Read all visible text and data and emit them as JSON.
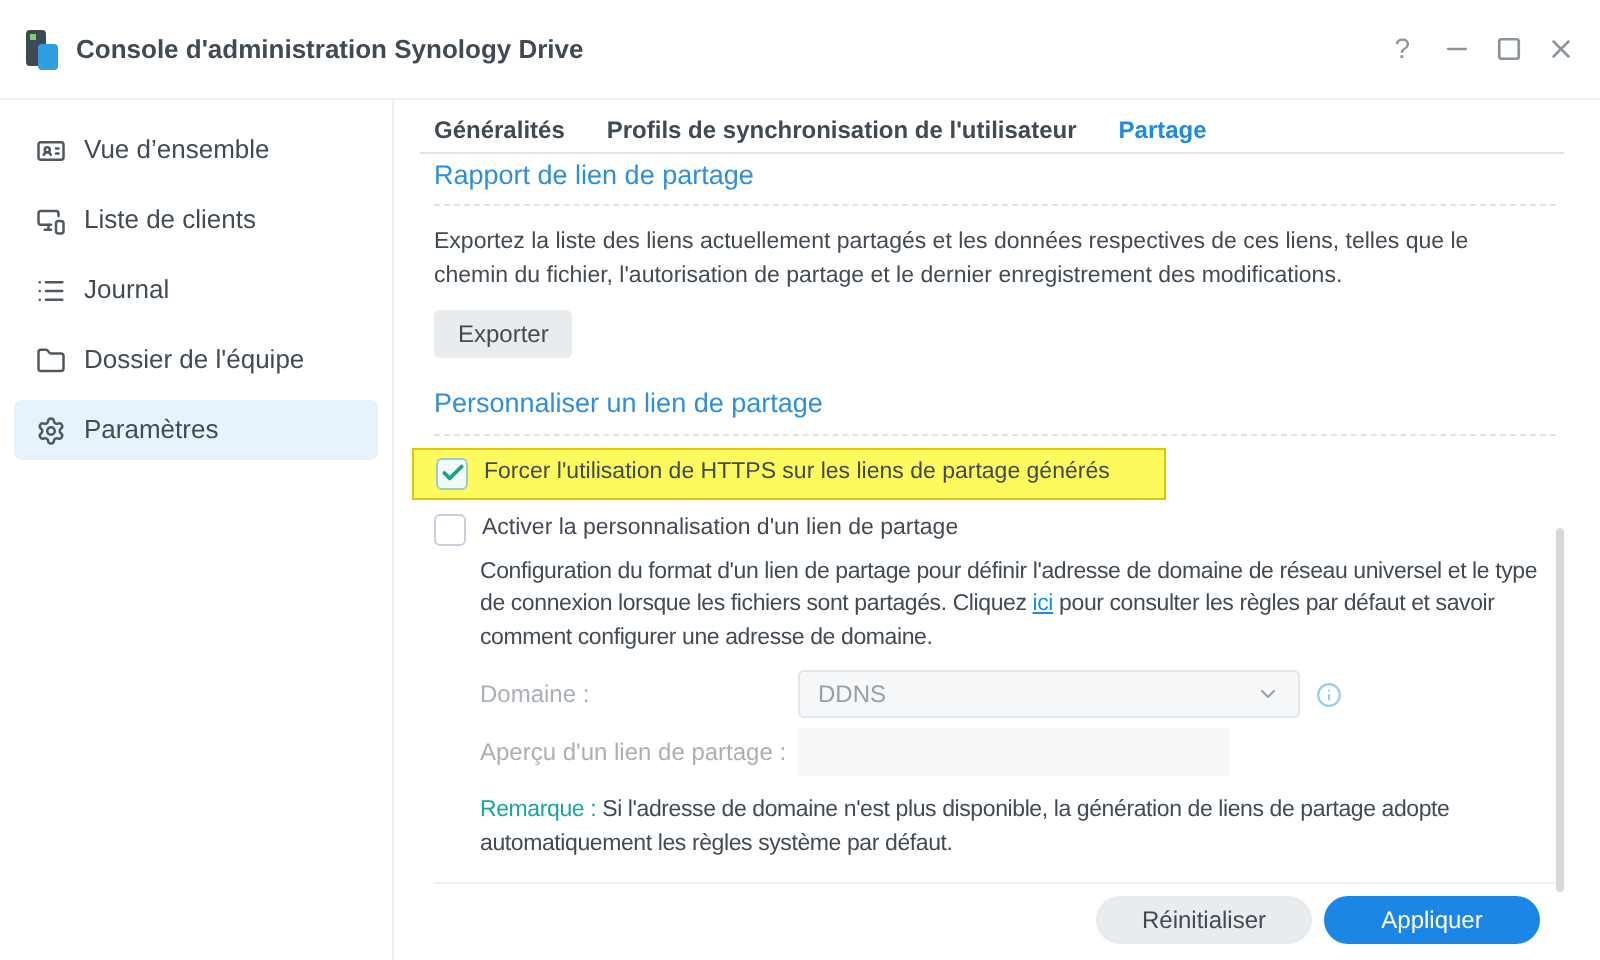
{
  "window": {
    "title": "Console d'administration Synology Drive",
    "help": "?"
  },
  "sidebar": {
    "items": [
      {
        "label": "Vue d’ensemble",
        "kind": "overview",
        "selected": false
      },
      {
        "label": "Liste de clients",
        "kind": "clients",
        "selected": false
      },
      {
        "label": "Journal",
        "kind": "log",
        "selected": false
      },
      {
        "label": "Dossier de l'équipe",
        "kind": "folder",
        "selected": false
      },
      {
        "label": "Paramètres",
        "kind": "settings",
        "selected": true
      }
    ]
  },
  "tabs": [
    {
      "label": "Généralités",
      "selected": false
    },
    {
      "label": "Profils de synchronisation de l'utilisateur",
      "selected": false
    },
    {
      "label": "Partage",
      "selected": true
    }
  ],
  "report": {
    "heading": "Rapport de lien de partage",
    "description": "Exportez la liste des liens actuellement partagés et les données respectives de ces liens, telles que le chemin du fichier, l'autorisation de partage et le dernier enregistrement des modifications.",
    "button": "Exporter"
  },
  "customize": {
    "heading": "Personnaliser un lien de partage",
    "force_https": {
      "label": "Forcer l'utilisation de HTTPS sur les liens de partage générés",
      "checked": true,
      "highlighted": true
    },
    "enable_custom": {
      "label": "Activer la personnalisation d'un lien de partage",
      "checked": false
    },
    "description_before": "Configuration du format d'un lien de partage pour définir l'adresse de domaine de réseau universel et le type de connexion lorsque les fichiers sont partagés. Cliquez",
    "link": "ici",
    "description_after": "pour consulter les règles par défaut et savoir comment configurer une adresse de domaine.",
    "domain": {
      "label": "Domaine :",
      "value": "DDNS",
      "disabled": true
    },
    "preview": {
      "label": "Aperçu d'un lien de partage :",
      "disabled": true
    },
    "note": {
      "label": "Remarque :",
      "text": "Si l'adresse de domaine n'est plus disponible, la génération de liens de partage adopte automatiquement les règles système par défaut."
    }
  },
  "footer": {
    "buttons": [
      {
        "label": "Réinitialiser",
        "kind": "secondary"
      },
      {
        "label": "Appliquer",
        "kind": "primary"
      }
    ]
  }
}
